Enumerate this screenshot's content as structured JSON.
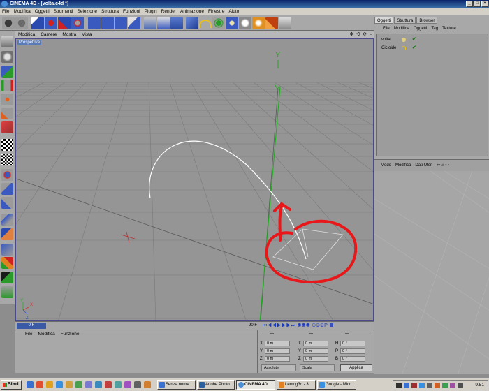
{
  "window": {
    "title": "CINEMA 4D - [volta.c4d *]",
    "min_label": "_",
    "max_label": "□",
    "close_label": "×"
  },
  "menubar": [
    "File",
    "Modifica",
    "Oggetti",
    "Strumenti",
    "Selezione",
    "Struttura",
    "Funzioni",
    "Plugin",
    "Render",
    "Animazione",
    "Finestre",
    "Aiuto"
  ],
  "toolbar": {
    "icons": [
      "undo-icon",
      "redo-icon",
      "pointer-icon",
      "move-icon",
      "scale-icon",
      "rotate-icon",
      "axis-x-icon",
      "axis-y-icon",
      "axis-z-icon",
      "coordinate-system-icon",
      "render-view-icon",
      "render-picture-queue-icon",
      "cube-primitive-icon",
      "spline-icon",
      "nurbs-icon",
      "array-icon",
      "deformer-icon",
      "scene-icon",
      "light-icon",
      "camera-icon",
      "help-icon"
    ]
  },
  "left_tools": {
    "icons": [
      "use-model-icon",
      "use-object-icon",
      "use-texture-icon",
      "use-axis-icon",
      "use-points-icon",
      "use-edges-icon",
      "use-polygons-icon",
      "tweak-icon",
      "soft-selection-icon",
      "magnet-icon",
      "live-selection-icon",
      "brush-icon",
      "knife-icon",
      "bridge-icon",
      "extrude-icon",
      "bevel-icon",
      "snap-icon",
      "xray-icon"
    ]
  },
  "viewport": {
    "menu": [
      "Modifica",
      "Camere",
      "Mostra",
      "Vista"
    ],
    "nav_icons": "✥ ⟲ ⟳ ▫",
    "label": "Prospettiva",
    "axis_y_label": "Y",
    "corner_axis_y": "Y",
    "corner_axis_x": "X",
    "corner_axis_z": "Z"
  },
  "timeline": {
    "current_frame": "0 F",
    "end_frame": "90 F",
    "transport": "⏮◀◀▶▶▶⏭ ◉◉◉ ⊕⊕⊕P ▦"
  },
  "material_manager": {
    "menu": [
      "File",
      "Modifica",
      "Funzione"
    ]
  },
  "coordinates": {
    "header": [
      "—",
      "—",
      "—"
    ],
    "rows": [
      {
        "a": "X",
        "av": "0 m",
        "b": "X",
        "bv": "0 m",
        "c": "H",
        "cv": "0 °"
      },
      {
        "a": "Y",
        "av": "0 m",
        "b": "Y",
        "bv": "0 m",
        "c": "P",
        "cv": "0 °"
      },
      {
        "a": "Z",
        "av": "0 m",
        "b": "Z",
        "bv": "0 m",
        "c": "B",
        "cv": "0 °"
      }
    ],
    "mode_select": "Assolute",
    "size_select": "Scala",
    "apply_label": "Applica"
  },
  "object_manager": {
    "tabs": [
      "Oggetti",
      "Struttura",
      "Browser"
    ],
    "menu": [
      "File",
      "Modifica",
      "Oggetti",
      "Tag",
      "Texture"
    ],
    "objects": [
      {
        "name": "volta",
        "icon": "null-object-icon",
        "visible": "✔"
      },
      {
        "name": "Cicloide",
        "icon": "spline-object-icon",
        "visible": "✔"
      }
    ]
  },
  "attribute_manager": {
    "menu": [
      "Modo",
      "Modifica",
      "Dati Uten"
    ],
    "icons": "⇦   ⌂ ▫ ▫"
  },
  "taskbar": {
    "start_label": "Start",
    "tasks": [
      {
        "label": "Senza nome ...",
        "active": false
      },
      {
        "label": "Adobe Photo...",
        "active": false
      },
      {
        "label": "CINEMA 4D ...",
        "active": true
      },
      {
        "label": "Lemog3d - 3...",
        "active": false
      },
      {
        "label": "Google - Micr...",
        "active": false
      }
    ],
    "clock": "9.51"
  },
  "colors": {
    "annotation_red": "#e8171a",
    "y_axis_green": "#1ab01a",
    "spline_white": "#ffffff",
    "grid": "#777777"
  }
}
